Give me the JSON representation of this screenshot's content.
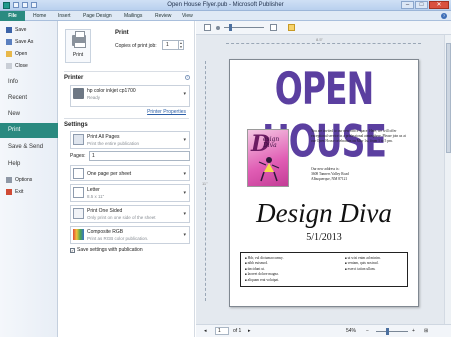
{
  "window": {
    "title": "Open House Flyer.pub - Microsoft Publisher"
  },
  "ribbon": {
    "file_tab": "File",
    "tabs": [
      "Home",
      "Insert",
      "Page Design",
      "Mailings",
      "Review",
      "View"
    ]
  },
  "backstage_nav": {
    "commands": [
      "Save",
      "Save As",
      "Open",
      "Close"
    ],
    "sections": [
      "Info",
      "Recent",
      "New",
      "Print",
      "Save & Send",
      "Help"
    ],
    "footer_commands": [
      "Options",
      "Exit"
    ],
    "active_section": "Print"
  },
  "print": {
    "heading": "Print",
    "print_button_label": "Print",
    "copies_label": "Copies of print job:",
    "copies_value": "1"
  },
  "printer": {
    "heading": "Printer",
    "name": "hp color inkjet cp1700",
    "status": "Ready",
    "properties_link": "Printer Properties"
  },
  "settings": {
    "heading": "Settings",
    "print_what": {
      "title": "Print All Pages",
      "subtitle": "Print the entire publication"
    },
    "pages_label": "Pages:",
    "pages_value": "1",
    "per_sheet": {
      "title": "One page per sheet"
    },
    "paper": {
      "title": "Letter",
      "subtitle": "8.5 x 11\""
    },
    "sides": {
      "title": "Print One Sided",
      "subtitle": "Only print on one side of the sheet"
    },
    "color": {
      "title": "Composite RGB",
      "subtitle": "Print as RGB color publication."
    },
    "save_settings_label": "Save settings with publication",
    "save_settings_checked": true
  },
  "preview": {
    "ruler_width": "8.5\"",
    "ruler_height": "11\"",
    "page_current": "1",
    "page_total_label": "of 1",
    "zoom_label": "54%"
  },
  "flyer": {
    "headline": "OPEN HOUSE",
    "logo_letter": "D",
    "logo_words": [
      "esign",
      "Diva"
    ],
    "invite_text": "You are invited to our new office space. Here, we will offer exceptional service in a professional atmosphere. Please join us at our Open House celebration on May 1st, from 1 to 5 pm.",
    "address_lines": [
      "Our new address is:",
      "3608 Tanners Valley Road",
      "Albuquerque, NM 87121"
    ],
    "business_name": "Design Diva",
    "date": "5/1/2013",
    "services_left": [
      "Hdr, vul dictumaccumsy.",
      "nibh euismod.",
      "tincidunt ut.",
      "laoreet dolore magna.",
      "aliquam erat volutpat."
    ],
    "services_right": [
      "ut wisi enim ad minim.",
      "veniam, quis nostrud.",
      "exerci tation ullam."
    ]
  },
  "colors": {
    "accent": "#2a8a80",
    "headline": "#5b3fa0",
    "link": "#2b5ea7"
  }
}
